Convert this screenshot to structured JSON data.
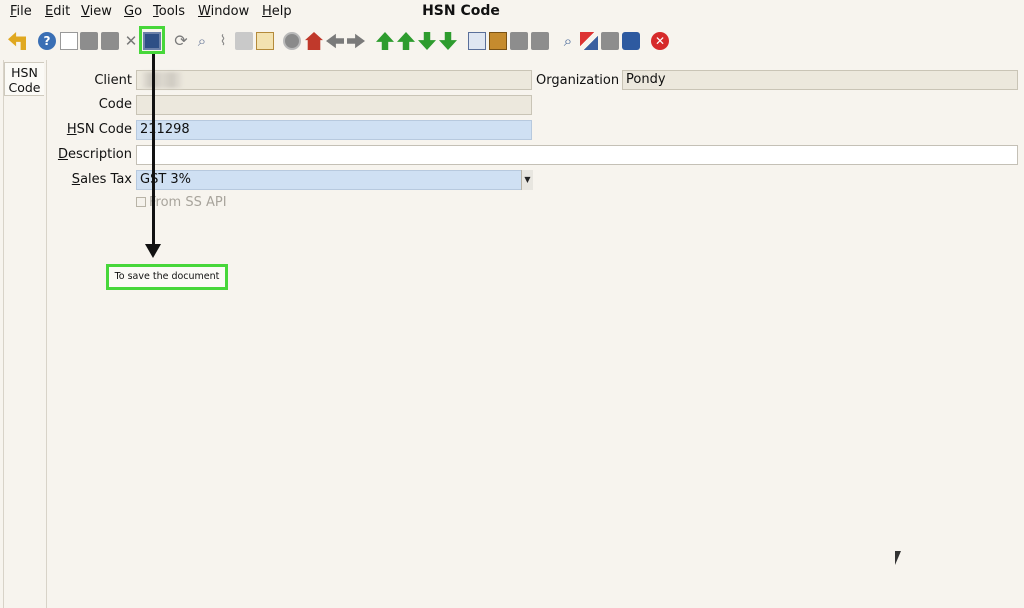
{
  "menu": {
    "file": {
      "first": "F",
      "rest": "ile"
    },
    "edit": {
      "first": "E",
      "rest": "dit"
    },
    "view": {
      "first": "V",
      "rest": "iew"
    },
    "go": {
      "first": "G",
      "rest": "o"
    },
    "tools": {
      "first": "T",
      "rest": "ools"
    },
    "window": {
      "first": "W",
      "rest": "indow"
    },
    "help": {
      "first": "H",
      "rest": "elp"
    }
  },
  "window_title": "HSN Code",
  "tab": {
    "label_line1": "HSN",
    "label_line2": "Code"
  },
  "form": {
    "client": {
      "label": "Client",
      "value": ""
    },
    "organization": {
      "label": "Organization",
      "value": "Pondy"
    },
    "code": {
      "label": "Code",
      "value": ""
    },
    "hsn_code": {
      "label_first": "H",
      "label_rest": "SN Code",
      "value": "211298"
    },
    "description": {
      "label_first": "D",
      "label_rest": "escription",
      "value": ""
    },
    "sales_tax": {
      "label_first": "S",
      "label_rest": "ales Tax",
      "value": "GST 3%"
    },
    "from_ss_api": {
      "label": "From SS API",
      "checked": false
    }
  },
  "annotation": {
    "tooltip": "To save the document",
    "highlight_color": "#47d73a"
  },
  "toolbar_icons": [
    "undo-icon",
    "help-icon",
    "new-icon",
    "copy-icon",
    "delete-icon",
    "delete-selection-icon",
    "save-icon",
    "refresh-icon",
    "find-icon",
    "attachment-icon",
    "chat-icon",
    "grid-toggle-icon",
    "history-icon",
    "home-icon",
    "back-icon",
    "forward-icon",
    "first-record-icon",
    "previous-record-icon",
    "next-record-icon",
    "last-record-icon",
    "report-icon",
    "archive-icon",
    "print-preview-icon",
    "print-icon",
    "zoom-across-icon",
    "active-workflows-icon",
    "requests-icon",
    "product-info-icon",
    "exit-icon"
  ]
}
